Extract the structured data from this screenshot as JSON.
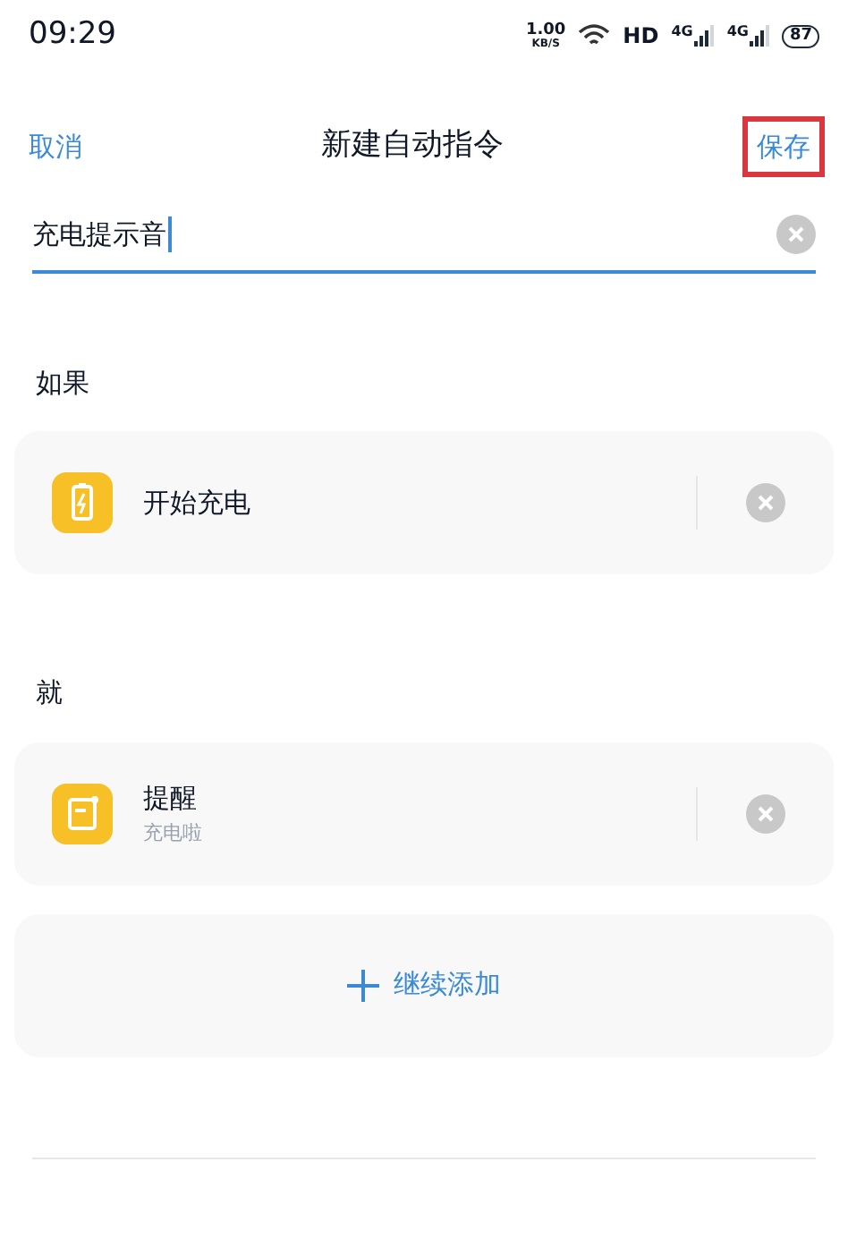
{
  "status_bar": {
    "time": "09:29",
    "speed": "1.00",
    "speed_unit": "KB/S",
    "hd": "HD",
    "signals": [
      "4G",
      "4G"
    ],
    "battery": "87"
  },
  "header": {
    "cancel": "取消",
    "title": "新建自动指令",
    "save": "保存",
    "save_highlighted": true
  },
  "name_field": {
    "value": "充电提示音"
  },
  "sections": [
    {
      "heading": "如果",
      "items": [
        {
          "kind": "battery",
          "title": "开始充电"
        }
      ]
    },
    {
      "heading": "就",
      "items": [
        {
          "kind": "reminder",
          "title": "提醒",
          "subtitle": "充电啦"
        }
      ]
    }
  ],
  "add_button": {
    "label": "继续添加"
  }
}
